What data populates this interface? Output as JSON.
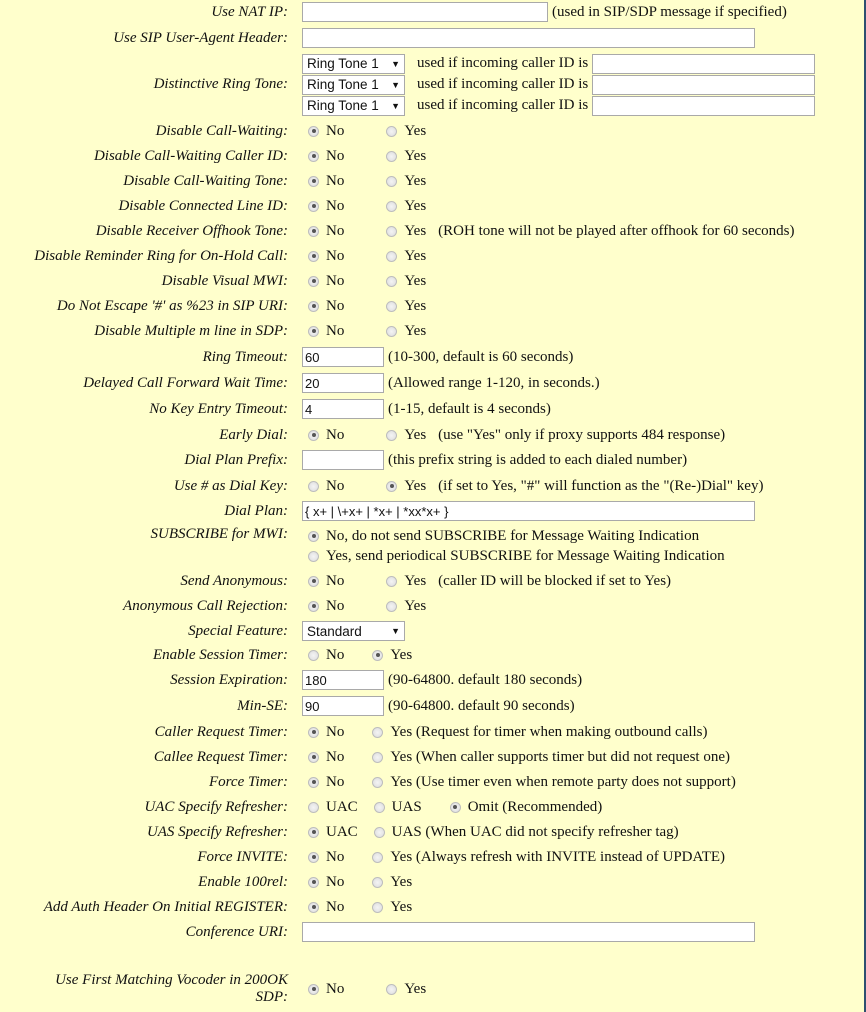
{
  "fields": {
    "use_nat_ip": {
      "label": "Use NAT IP:",
      "value": "",
      "note": "(used in SIP/SDP message if specified)"
    },
    "sip_user_agent": {
      "label": "Use SIP User-Agent Header:",
      "value": ""
    },
    "distinctive_ring": {
      "label": "Distinctive Ring Tone:",
      "rows": [
        {
          "tone": "Ring Tone 1",
          "text": "used if incoming caller ID is",
          "value": ""
        },
        {
          "tone": "Ring Tone 1",
          "text": "used if incoming caller ID is",
          "value": ""
        },
        {
          "tone": "Ring Tone 1",
          "text": "used if incoming caller ID is",
          "value": ""
        }
      ]
    },
    "disable_call_waiting": {
      "label": "Disable Call-Waiting:",
      "options": [
        "No",
        "Yes"
      ],
      "selected": "No"
    },
    "disable_cw_caller_id": {
      "label": "Disable Call-Waiting Caller ID:",
      "options": [
        "No",
        "Yes"
      ],
      "selected": "No"
    },
    "disable_cw_tone": {
      "label": "Disable Call-Waiting Tone:",
      "options": [
        "No",
        "Yes"
      ],
      "selected": "No"
    },
    "disable_connected_line": {
      "label": "Disable Connected Line ID:",
      "options": [
        "No",
        "Yes"
      ],
      "selected": "No"
    },
    "disable_roh_tone": {
      "label": "Disable Receiver Offhook Tone:",
      "options": [
        "No",
        "Yes"
      ],
      "selected": "No",
      "note": "(ROH tone will not be played after offhook for 60 seconds)"
    },
    "disable_reminder_ring": {
      "label": "Disable Reminder Ring for On-Hold Call:",
      "options": [
        "No",
        "Yes"
      ],
      "selected": "No"
    },
    "disable_visual_mwi": {
      "label": "Disable Visual MWI:",
      "options": [
        "No",
        "Yes"
      ],
      "selected": "No"
    },
    "do_not_escape": {
      "label": "Do Not Escape '#' as %23 in SIP URI:",
      "options": [
        "No",
        "Yes"
      ],
      "selected": "No"
    },
    "disable_multiple_m": {
      "label": "Disable Multiple m line in SDP:",
      "options": [
        "No",
        "Yes"
      ],
      "selected": "No"
    },
    "ring_timeout": {
      "label": "Ring Timeout:",
      "value": "60",
      "note": "(10-300, default is 60 seconds)"
    },
    "delayed_cf_wait": {
      "label": "Delayed Call Forward Wait Time:",
      "value": "20",
      "note": "(Allowed range 1-120, in seconds.)"
    },
    "no_key_entry": {
      "label": "No Key Entry Timeout:",
      "value": "4",
      "note": "(1-15, default is 4 seconds)"
    },
    "early_dial": {
      "label": "Early Dial:",
      "options": [
        "No",
        "Yes"
      ],
      "selected": "No",
      "note": "(use \"Yes\" only if proxy supports 484 response)"
    },
    "dial_plan_prefix": {
      "label": "Dial Plan Prefix:",
      "value": "",
      "note": "(this prefix string is added to each dialed number)"
    },
    "use_hash_dial": {
      "label": "Use # as Dial Key:",
      "options": [
        "No",
        "Yes"
      ],
      "selected": "Yes",
      "note": "(if set to Yes, \"#\" will function as the \"(Re-)Dial\" key)"
    },
    "dial_plan": {
      "label": "Dial Plan:",
      "value": "{ x+ | \\+x+ | *x+ | *xx*x+ }"
    },
    "subscribe_mwi": {
      "label": "SUBSCRIBE for MWI:",
      "options": [
        "No, do not send SUBSCRIBE for Message Waiting Indication",
        "Yes, send periodical SUBSCRIBE for Message Waiting Indication"
      ],
      "selected": 0
    },
    "send_anonymous": {
      "label": "Send Anonymous:",
      "options": [
        "No",
        "Yes"
      ],
      "selected": "No",
      "note": "(caller ID will be blocked if set to Yes)"
    },
    "anon_call_rejection": {
      "label": "Anonymous Call Rejection:",
      "options": [
        "No",
        "Yes"
      ],
      "selected": "No"
    },
    "special_feature": {
      "label": "Special Feature:",
      "value": "Standard"
    },
    "enable_session_timer": {
      "label": "Enable Session Timer:",
      "options": [
        "No",
        "Yes"
      ],
      "selected": "Yes"
    },
    "session_expiration": {
      "label": "Session Expiration:",
      "value": "180",
      "note": "(90-64800. default 180 seconds)"
    },
    "min_se": {
      "label": "Min-SE:",
      "value": "90",
      "note": "(90-64800. default 90 seconds)"
    },
    "caller_request_timer": {
      "label": "Caller Request Timer:",
      "options": [
        "No",
        "Yes (Request for timer when making outbound calls)"
      ],
      "selected": "No"
    },
    "callee_request_timer": {
      "label": "Callee Request Timer:",
      "options": [
        "No",
        "Yes (When caller supports timer but did not request one)"
      ],
      "selected": "No"
    },
    "force_timer": {
      "label": "Force Timer:",
      "options": [
        "No",
        "Yes (Use timer even when remote party does not support)"
      ],
      "selected": "No"
    },
    "uac_refresher": {
      "label": "UAC Specify Refresher:",
      "options": [
        "UAC",
        "UAS",
        "Omit (Recommended)"
      ],
      "selected": "Omit (Recommended)"
    },
    "uas_refresher": {
      "label": "UAS Specify Refresher:",
      "options": [
        "UAC",
        "UAS (When UAC did not specify refresher tag)"
      ],
      "selected": "UAC"
    },
    "force_invite": {
      "label": "Force INVITE:",
      "options": [
        "No",
        "Yes (Always refresh with INVITE instead of UPDATE)"
      ],
      "selected": "No"
    },
    "enable_100rel": {
      "label": "Enable 100rel:",
      "options": [
        "No",
        "Yes"
      ],
      "selected": "No"
    },
    "add_auth_header": {
      "label": "Add Auth Header On Initial REGISTER:",
      "options": [
        "No",
        "Yes"
      ],
      "selected": "No"
    },
    "conference_uri": {
      "label": "Conference URI:",
      "value": ""
    },
    "first_matching_vocoder": {
      "label_line1": "Use First Matching Vocoder in 200OK",
      "label_line2": "SDP:",
      "options": [
        "No",
        "Yes"
      ],
      "selected": "No"
    }
  }
}
